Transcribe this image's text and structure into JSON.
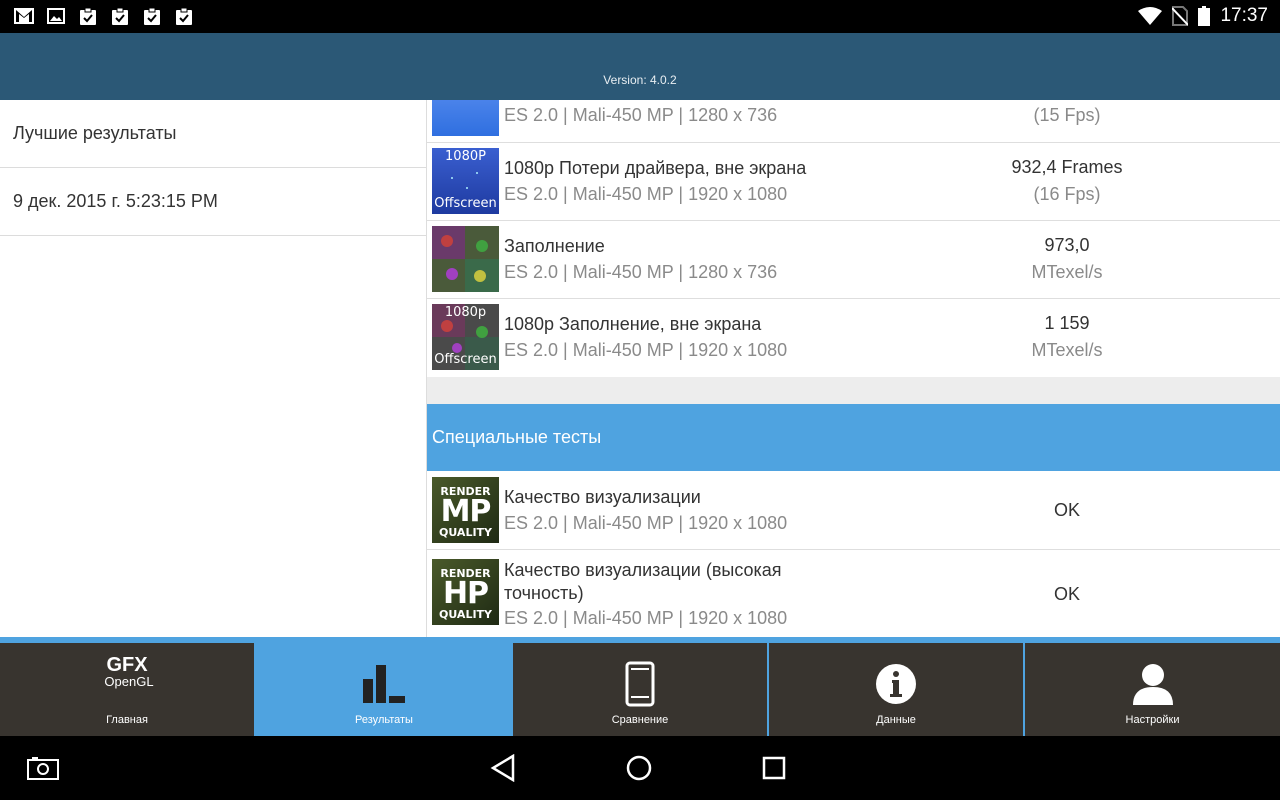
{
  "statusbar": {
    "time": "17:37",
    "icons": [
      "gmail-icon",
      "gallery-icon",
      "clipboard-check-icon",
      "clipboard-check-icon",
      "clipboard-check-icon",
      "clipboard-check-icon",
      "wifi-icon",
      "no-sim-icon",
      "battery-icon"
    ]
  },
  "header": {
    "version": "Version: 4.0.2"
  },
  "left": {
    "items": [
      {
        "label": "Лучшие результаты"
      },
      {
        "label": "9 дек. 2015 г. 5:23:15 PM"
      }
    ]
  },
  "results": [
    {
      "thumb_top": "",
      "thumb_bottom": "",
      "title": "",
      "subtitle": "ES 2.0 | Mali-450 MP | 1280 x 736",
      "value": "",
      "value2": "(15 Fps)"
    },
    {
      "thumb_top": "1080P",
      "thumb_bottom": "Offscreen",
      "title": "1080p Потери драйвера, вне экрана",
      "subtitle": "ES 2.0 | Mali-450 MP | 1920 x 1080",
      "value": "932,4 Frames",
      "value2": "(16 Fps)"
    },
    {
      "thumb_top": "",
      "thumb_bottom": "",
      "title": "Заполнение",
      "subtitle": "ES 2.0 | Mali-450 MP | 1280 x 736",
      "value": "973,0",
      "value2": "MTexel/s"
    },
    {
      "thumb_top": "1080p",
      "thumb_bottom": "Offscreen",
      "title": "1080p Заполнение, вне экрана",
      "subtitle": "ES 2.0 | Mali-450 MP | 1920 x 1080",
      "value": "1 159",
      "value2": "MTexel/s"
    }
  ],
  "special": {
    "section_title": "Специальные тесты",
    "items": [
      {
        "thumb_top": "RENDER",
        "thumb_mid": "MP",
        "thumb_bottom": "QUALITY",
        "title": "Качество визуализации",
        "subtitle": "ES 2.0 | Mali-450 MP | 1920 x 1080",
        "value": "OK"
      },
      {
        "thumb_top": "RENDER",
        "thumb_mid": "HP",
        "thumb_bottom": "QUALITY",
        "title": "Качество визуализации (высокая точность)",
        "subtitle": "ES 2.0 | Mali-450 MP | 1920 x 1080",
        "value": "OK"
      }
    ]
  },
  "tabs": [
    {
      "label": "Главная",
      "logo_top": "GFX",
      "logo_bottom": "OpenGL",
      "active": false
    },
    {
      "label": "Результаты",
      "icon": "bar-chart-icon",
      "active": true
    },
    {
      "label": "Сравнение",
      "icon": "phone-icon",
      "active": false
    },
    {
      "label": "Данные",
      "icon": "info-icon",
      "active": false
    },
    {
      "label": "Настройки",
      "icon": "person-icon",
      "active": false
    }
  ],
  "navbar": {
    "icons": [
      "screenshot-icon",
      "back-icon",
      "home-icon",
      "recents-icon"
    ]
  },
  "colors": {
    "header": "#2b5876",
    "accent": "#4fa3e0",
    "tab_bg": "#38342f"
  }
}
